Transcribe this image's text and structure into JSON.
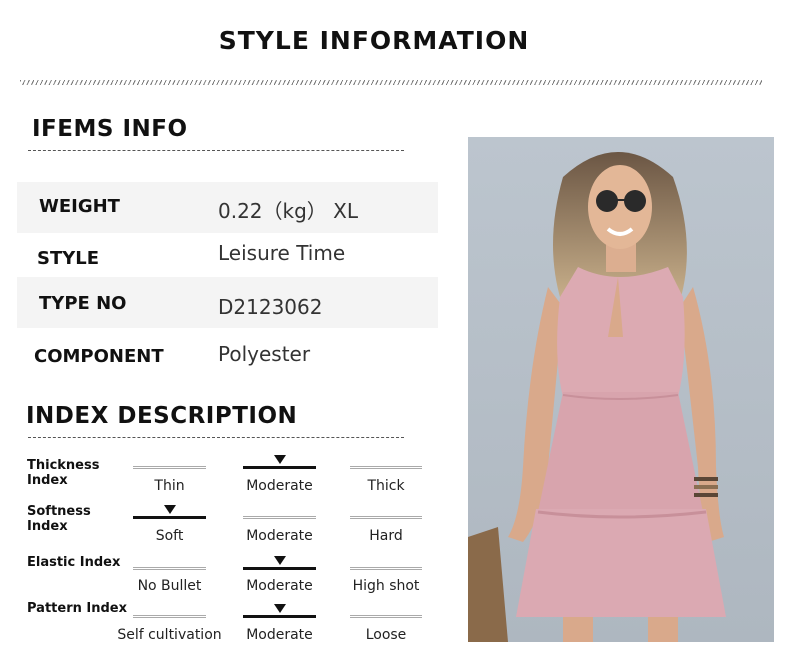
{
  "title": "STYLE INFORMATION",
  "items_info": {
    "heading": "IFEMS INFO",
    "rows": [
      {
        "label": "WEIGHT",
        "value": "0.22（kg） XL"
      },
      {
        "label": "STYLE",
        "value": "Leisure Time"
      },
      {
        "label": "TYPE NO",
        "value": "D2123062"
      },
      {
        "label": "COMPONENT",
        "value": "Polyester"
      }
    ]
  },
  "index_description": {
    "heading": "INDEX DESCRIPTION",
    "indices": [
      {
        "label": "Thickness Index",
        "options": [
          "Thin",
          "Moderate",
          "Thick"
        ],
        "selected": "Moderate"
      },
      {
        "label": "Softness Index",
        "options": [
          "Soft",
          "Moderate",
          "Hard"
        ],
        "selected": "Soft"
      },
      {
        "label": "Elastic Index",
        "options": [
          "No Bullet",
          "Moderate",
          "High shot"
        ],
        "selected": "Moderate"
      },
      {
        "label": "Pattern Index",
        "options": [
          "Self cultivation",
          "Moderate",
          "Loose"
        ],
        "selected": "Moderate"
      }
    ]
  },
  "colors": {
    "dress": "#dcaab2",
    "background": "#b9c3cc",
    "accent": "#111111"
  }
}
